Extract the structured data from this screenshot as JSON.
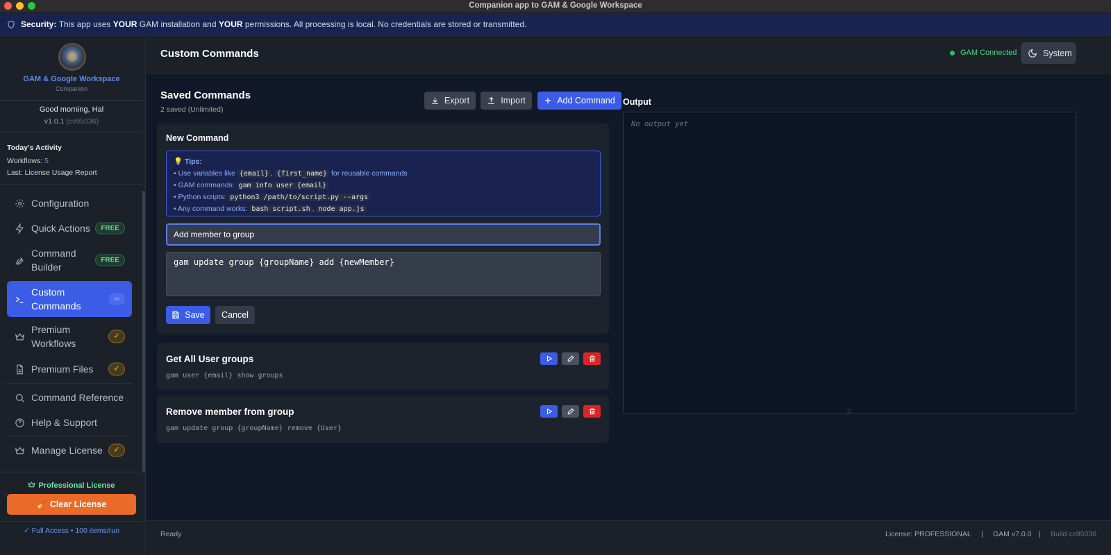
{
  "window": {
    "title": "Companion app to GAM & Google Workspace"
  },
  "security": {
    "label": "Security:",
    "text_1": "This app uses",
    "em_1": "YOUR",
    "text_2": "GAM installation and",
    "em_2": "YOUR",
    "text_3": "permissions. All processing is local. No credentials are stored or transmitted."
  },
  "sidebar": {
    "brand_title": "GAM & Google Workspace",
    "brand_subtitle": "Companion",
    "greeting": "Good morning, Hal",
    "version": "v1.0.1",
    "build_hash": "(cc95036)",
    "activity": {
      "heading": "Today's Activity",
      "workflows_label": "Workflows:",
      "workflows_count": "5",
      "last": "Last: License Usage Report"
    },
    "items": [
      {
        "label": "Configuration",
        "icon": "gear-icon"
      },
      {
        "label": "Quick Actions",
        "icon": "lightning-icon",
        "badge": "FREE"
      },
      {
        "label": "Command Builder",
        "icon": "wrench-icon",
        "badge": "FREE"
      },
      {
        "label": "Custom Commands",
        "icon": "terminal-icon",
        "badge": "∞",
        "active": true
      },
      {
        "label": "Premium Workflows",
        "icon": "crown-icon",
        "badge": "✓"
      },
      {
        "label": "Premium Files",
        "icon": "file-icon",
        "badge": "✓"
      },
      {
        "label": "Command Reference",
        "icon": "search-icon"
      },
      {
        "label": "Help & Support",
        "icon": "help-icon"
      },
      {
        "label": "Manage License",
        "icon": "crown-icon",
        "badge": "✓"
      }
    ],
    "license_label": "Professional License",
    "clear_license": "🧹 Clear License",
    "full_access": "✓ Full Access • 100 items/run"
  },
  "header": {
    "title": "Custom Commands",
    "status": "GAM Connected",
    "theme_button": "System"
  },
  "saved": {
    "heading": "Saved Commands",
    "subtitle": "2 saved (Unlimited)",
    "export_label": "Export",
    "import_label": "Import",
    "add_label": "Add Command"
  },
  "new_command": {
    "heading": "New Command",
    "tips_heading": "💡 Tips:",
    "tips": [
      {
        "pre": "Use variables like ",
        "code1": "{email}",
        "mid": ", ",
        "code2": "{first_name}",
        "post": " for reusable commands"
      },
      {
        "pre": "GAM commands: ",
        "code1": "gam info user {email}"
      },
      {
        "pre": "Python scripts: ",
        "code1": "python3 /path/to/script.py --args"
      },
      {
        "pre": "Any command works: ",
        "code1": "bash script.sh",
        "mid": ", ",
        "code2": "node app.js"
      }
    ],
    "name_value": "Add member to group",
    "command_value": "gam update group {groupName} add {newMember}",
    "save_label": "Save",
    "cancel_label": "Cancel"
  },
  "commands": [
    {
      "name": "Get All User groups",
      "command": "gam user {email} show groups"
    },
    {
      "name": "Remove member from group",
      "command": "gam update group {groupName} remove {User}"
    }
  ],
  "output": {
    "heading": "Output",
    "placeholder": "No output yet"
  },
  "statusbar": {
    "left": "Ready",
    "license": "License: PROFESSIONAL",
    "sep": "|",
    "gam": "GAM v7.0.0",
    "build": "Build cc95036"
  },
  "colors": {
    "accent": "#3b5ce6",
    "success": "#22c55e",
    "danger": "#dc2626",
    "warning": "#ea6a27"
  }
}
